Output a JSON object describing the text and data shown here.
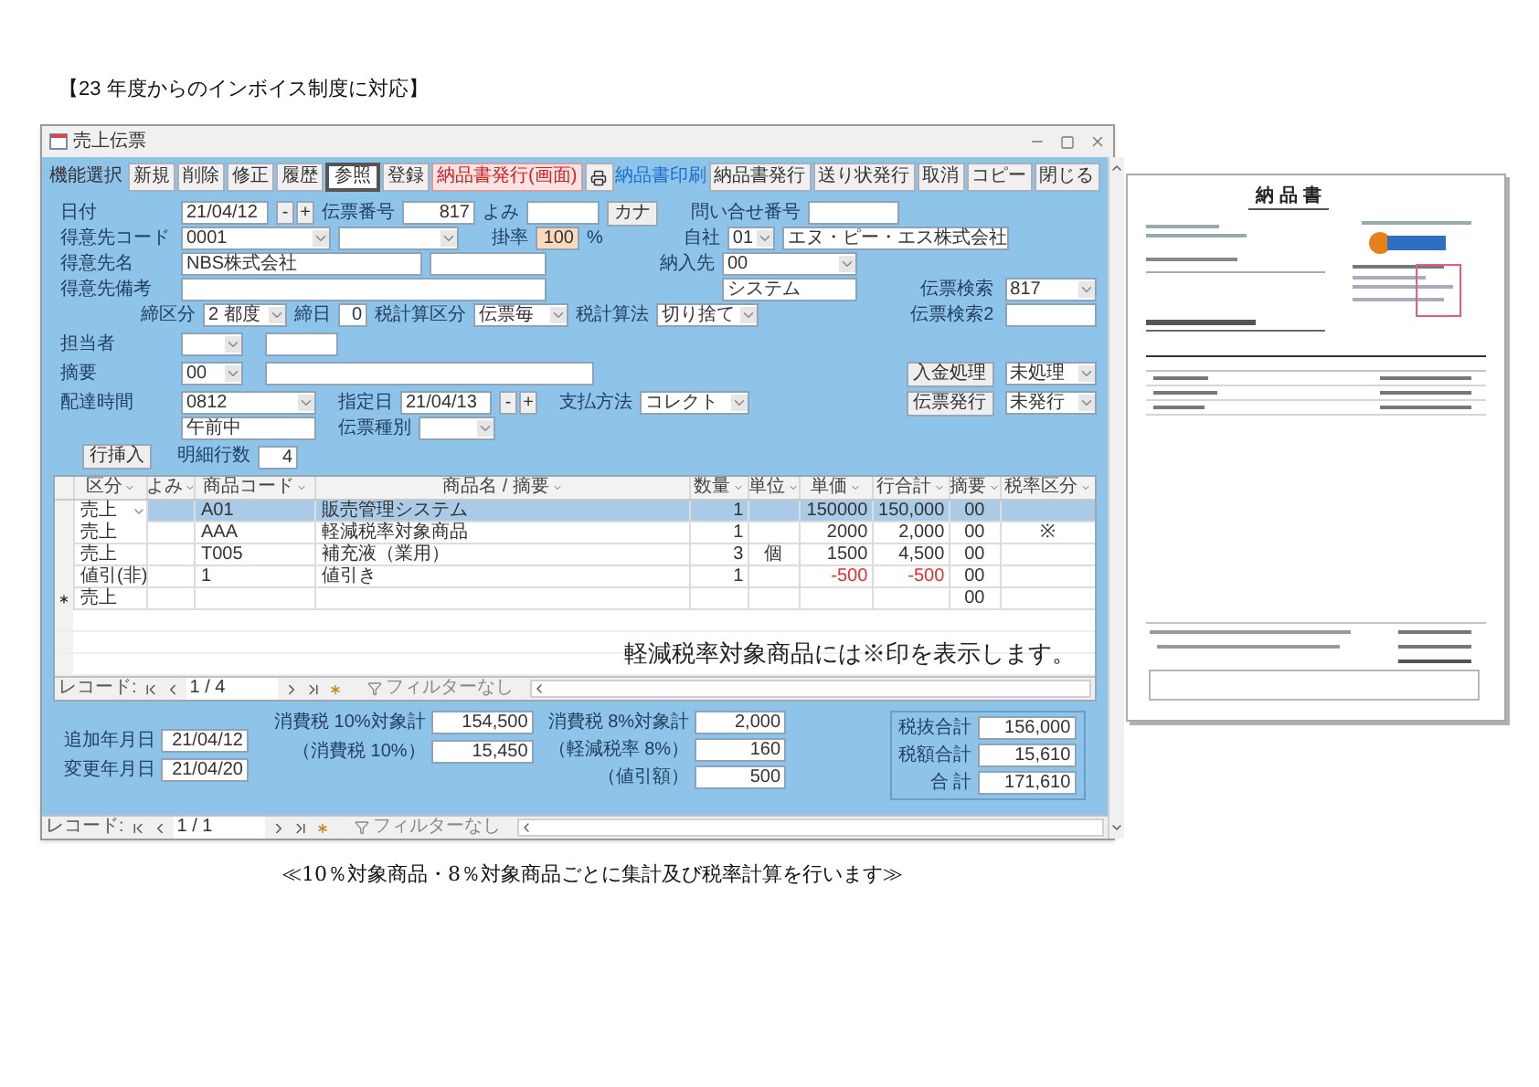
{
  "heading": "【23 年度からのインボイス制度に対応】",
  "window": {
    "title": "売上伝票"
  },
  "toolbar": {
    "label": "機能選択",
    "buttons": [
      {
        "kind": "plain",
        "label": "新規"
      },
      {
        "kind": "plain",
        "label": "削除"
      },
      {
        "kind": "plain",
        "label": "修正"
      },
      {
        "kind": "plain",
        "label": "履歴"
      },
      {
        "kind": "boxed",
        "label": "参照"
      },
      {
        "kind": "plain",
        "label": "登録"
      },
      {
        "kind": "alert",
        "label": "納品書発行(画面)"
      },
      {
        "kind": "print"
      },
      {
        "kind": "link",
        "label": "納品書印刷"
      },
      {
        "kind": "plain",
        "label": "納品書発行"
      },
      {
        "kind": "plain",
        "label": "送り状発行"
      },
      {
        "kind": "plain",
        "label": "取消"
      },
      {
        "kind": "plain",
        "label": "コピー"
      },
      {
        "kind": "plain",
        "label": "閉じる"
      }
    ]
  },
  "form": {
    "date": {
      "label": "日付",
      "value": "21/04/12",
      "stepper": [
        "-",
        "+"
      ]
    },
    "slip_no": {
      "label": "伝票番号",
      "value": "817"
    },
    "reading": {
      "label": "よみ",
      "button": "カナ"
    },
    "inquiry_no": {
      "label": "問い合せ番号"
    },
    "customer_code": {
      "label": "得意先コード",
      "value": "0001"
    },
    "rate": {
      "label": "掛率",
      "value": "100",
      "unit": "%"
    },
    "company": {
      "label": "自社",
      "code": "01",
      "name": "エヌ・ピー・エス株式会社"
    },
    "customer_name": {
      "label": "得意先名",
      "value": "NBS株式会社"
    },
    "delivery_to": {
      "label": "納入先",
      "code": "00",
      "name": "システム"
    },
    "customer_note": {
      "label": "得意先備考"
    },
    "slip_search": {
      "label": "伝票検索",
      "value": "817"
    },
    "closing_type": {
      "label": "締区分",
      "value": "2 都度"
    },
    "closing_day": {
      "label": "締日",
      "value": "0"
    },
    "tax_calc_type": {
      "label": "税計算区分",
      "value": "伝票毎"
    },
    "tax_calc_method": {
      "label": "税計算法",
      "value": "切り捨て"
    },
    "slip_search2": {
      "label": "伝票検索2"
    },
    "staff": {
      "label": "担当者"
    },
    "summary": {
      "label": "摘要",
      "code": "00"
    },
    "payment_processing": {
      "label": "入金処理",
      "value": "未処理"
    },
    "delivery_time": {
      "label": "配達時間",
      "code": "0812",
      "name": "午前中"
    },
    "designated_date": {
      "label": "指定日",
      "value": "21/04/13",
      "stepper": [
        "-",
        "+"
      ]
    },
    "payment_method": {
      "label": "支払方法",
      "value": "コレクト"
    },
    "slip_issue": {
      "label": "伝票発行",
      "value": "未発行"
    },
    "slip_type": {
      "label": "伝票種別"
    },
    "insert_row": "行挿入",
    "line_count": {
      "label": "明細行数",
      "value": "4"
    }
  },
  "grid": {
    "columns": [
      "区分",
      "よみ",
      "商品コード",
      "商品名 / 摘要",
      "数量",
      "単位",
      "単価",
      "行合計",
      "摘要",
      "税率区分"
    ],
    "rows": [
      {
        "selected": true,
        "new": false,
        "discount": false,
        "cells": [
          "売上",
          "",
          "A01",
          "販売管理システム",
          "1",
          "",
          "150000",
          "150,000",
          "00",
          ""
        ]
      },
      {
        "selected": false,
        "new": false,
        "discount": false,
        "cells": [
          "売上",
          "",
          "AAA",
          "軽減税率対象商品",
          "1",
          "",
          "2000",
          "2,000",
          "00",
          "※"
        ]
      },
      {
        "selected": false,
        "new": false,
        "discount": false,
        "cells": [
          "売上",
          "",
          "T005",
          "補充液（業用）",
          "3",
          "個",
          "1500",
          "4,500",
          "00",
          ""
        ]
      },
      {
        "selected": false,
        "new": false,
        "discount": true,
        "cells": [
          "値引(非)",
          "",
          "1",
          "値引き",
          "1",
          "",
          "-500",
          "-500",
          "00",
          ""
        ]
      },
      {
        "selected": false,
        "new": true,
        "discount": false,
        "cells": [
          "売上",
          "",
          "",
          "",
          "",
          "",
          "",
          "",
          "00",
          ""
        ]
      }
    ],
    "note": "軽減税率対象商品には※印を表示します。",
    "nav": {
      "label": "レコード:",
      "position": "1 / 4",
      "filter": "フィルターなし"
    }
  },
  "totals": {
    "dates": [
      {
        "label": "追加年月日",
        "value": "21/04/12"
      },
      {
        "label": "変更年月日",
        "value": "21/04/20"
      }
    ],
    "tax10": [
      {
        "label": "消費税 10%対象計",
        "value": "154,500"
      },
      {
        "label": "（消費税 10%）",
        "value": "15,450"
      }
    ],
    "tax8": [
      {
        "label": "消費税 8%対象計",
        "value": "2,000"
      },
      {
        "label": "（軽減税率 8%）",
        "value": "160"
      },
      {
        "label": "（値引額）",
        "value": "500"
      }
    ],
    "summary": [
      {
        "label": "税抜合計",
        "value": "156,000"
      },
      {
        "label": "税額合計",
        "value": "15,610"
      },
      {
        "label": "合 計",
        "value": "171,610"
      }
    ]
  },
  "window_nav": {
    "label": "レコード:",
    "position": "1 / 1",
    "filter": "フィルターなし"
  },
  "invoice": {
    "title": "納 品 書"
  },
  "caption": "≪10％対象商品・8％対象商品ごとに集計及び税率計算を行います≫"
}
